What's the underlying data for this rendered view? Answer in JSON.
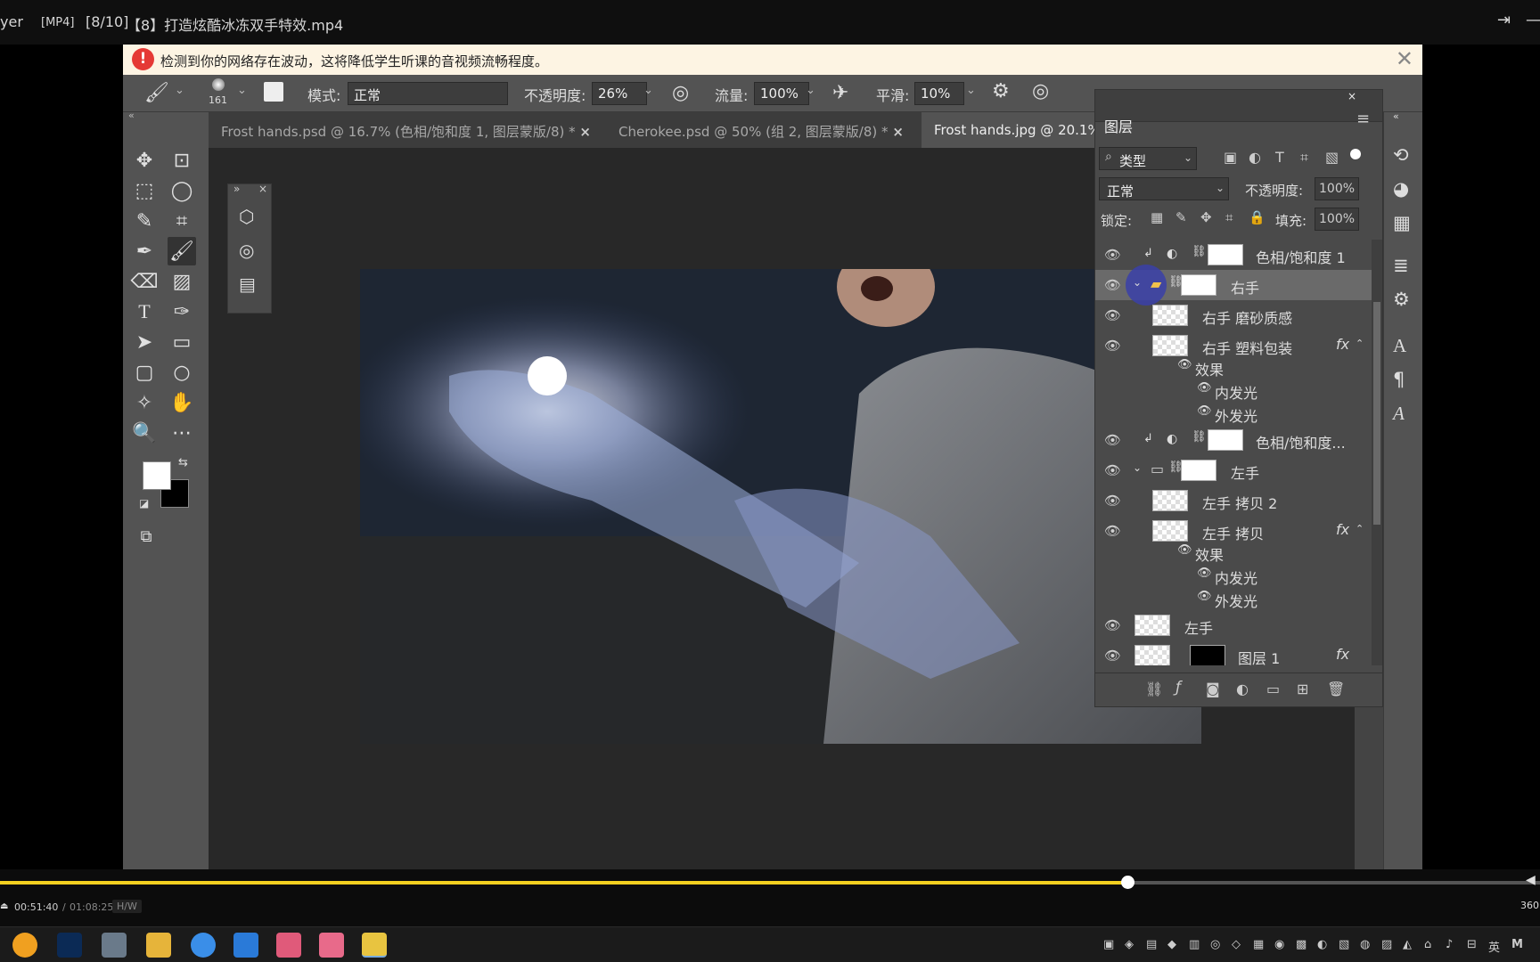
{
  "player": {
    "app_fragment": "yer",
    "format": "[MP4]",
    "index": "[8/10]",
    "filename": "【8】打造炫酷冰冻双手特效.mp4",
    "pin_icon": "pin-icon",
    "elapsed": "00:51:40",
    "total": "01:08:25",
    "hw_badge": "H/W",
    "progress_fraction": 0.732,
    "right_label": "360",
    "accent": "#f5d020"
  },
  "notice": {
    "text": "检测到你的网络存在波动，这将降低学生听课的音视频流畅程度。",
    "warn_glyph": "!",
    "close_glyph": "✕"
  },
  "options": {
    "brush_size": "161",
    "mode_label": "模式:",
    "mode_value": "正常",
    "opacity_label": "不透明度:",
    "opacity_value": "26%",
    "flow_label": "流量:",
    "flow_value": "100%",
    "smooth_label": "平滑:",
    "smooth_value": "10%"
  },
  "tabs": [
    {
      "label": "Frost hands.psd @ 16.7% (色相/饱和度 1, 图层蒙版/8) *",
      "close": "×"
    },
    {
      "label": "Cherokee.psd @ 50% (组 2, 图层蒙版/8) *",
      "close": "×"
    },
    {
      "label": "Frost hands.jpg @ 20.1%"
    }
  ],
  "layers_panel": {
    "title": "图层",
    "filter_kind": "类型",
    "blend_mode": "正常",
    "opacity_label": "不透明度:",
    "opacity_value": "100%",
    "lock_label": "锁定:",
    "fill_label": "填充:",
    "fill_value": "100%",
    "rows": [
      {
        "name": "色相/饱和度 1"
      },
      {
        "name": "右手"
      },
      {
        "name": "右手 磨砂质感"
      },
      {
        "name": "右手 塑料包装",
        "fx": "fx"
      },
      {
        "name": "效果"
      },
      {
        "name": "内发光"
      },
      {
        "name": "外发光"
      },
      {
        "name": "色相/饱和度..."
      },
      {
        "name": "左手"
      },
      {
        "name": "左手 拷贝 2"
      },
      {
        "name": "左手 拷贝",
        "fx": "fx"
      },
      {
        "name": "效果"
      },
      {
        "name": "内发光"
      },
      {
        "name": "外发光"
      },
      {
        "name": "左手"
      },
      {
        "name": "图层 1",
        "fx": "fx"
      }
    ]
  }
}
